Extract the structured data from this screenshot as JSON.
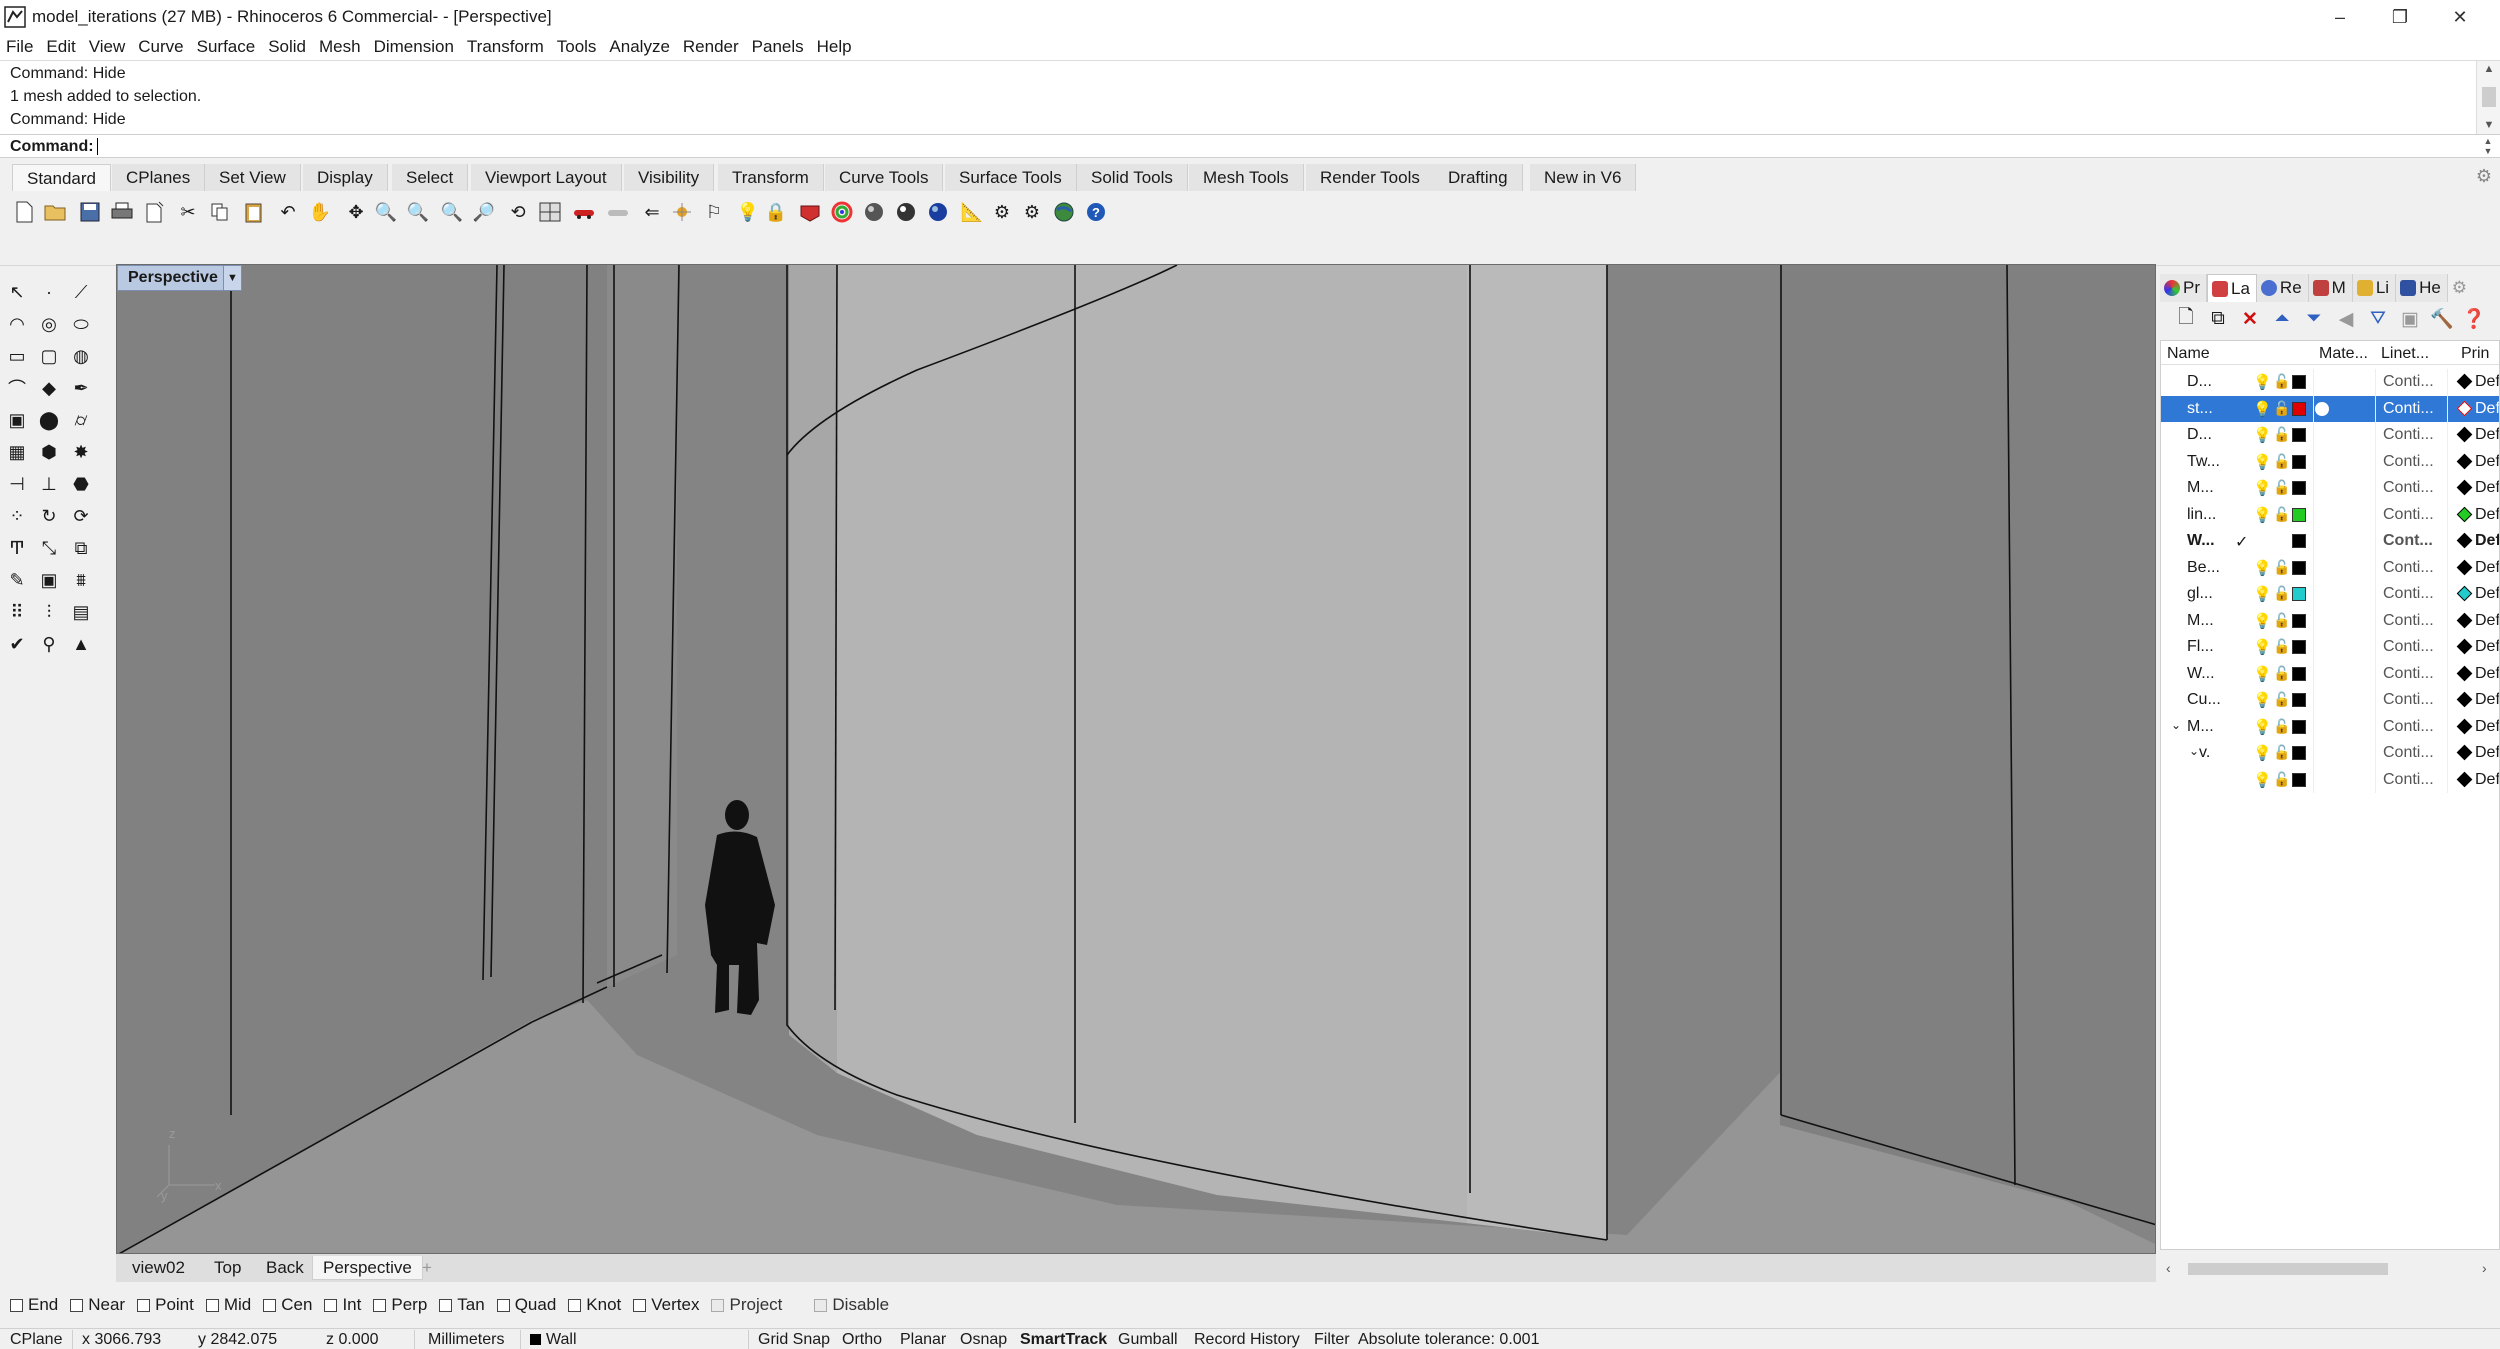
{
  "window": {
    "title": "model_iterations (27 MB) - Rhinoceros 6 Commercial- - [Perspective]",
    "minimize": "–",
    "maximize": "❐",
    "close": "✕"
  },
  "menu": [
    "File",
    "Edit",
    "View",
    "Curve",
    "Surface",
    "Solid",
    "Mesh",
    "Dimension",
    "Transform",
    "Tools",
    "Analyze",
    "Render",
    "Panels",
    "Help"
  ],
  "command_history": [
    "Command: Hide",
    "1 mesh added to selection.",
    "Command: Hide"
  ],
  "command_prompt": {
    "label": "Command:",
    "value": ""
  },
  "toolbar_tabs": [
    "Standard",
    "CPlanes",
    "Set View",
    "Display",
    "Select",
    "Viewport Layout",
    "Visibility",
    "Transform",
    "Curve Tools",
    "Surface Tools",
    "Solid Tools",
    "Mesh Tools",
    "Render Tools",
    "Drafting",
    "New in V6"
  ],
  "toolbar_icons": [
    "new-file",
    "open-file",
    "save",
    "print",
    "import",
    "cut",
    "copy",
    "paste",
    "undo",
    "pan",
    "rotate-view",
    "zoom",
    "zoom-window",
    "zoom-extents",
    "zoom-selected",
    "undo-view",
    "4-views",
    "car-select",
    "hide",
    "show",
    "lock",
    "unlock",
    "light",
    "padlock",
    "render-material",
    "color-wheel",
    "shade-sphere",
    "render-sphere",
    "render-blue",
    "dimension",
    "settings",
    "options",
    "earth",
    "help"
  ],
  "viewport": {
    "name": "Perspective",
    "axis_z": "z",
    "axis_y": "y",
    "axis_x": "x"
  },
  "viewport_tabs": [
    "view02",
    "Top",
    "Back",
    "Perspective",
    "+"
  ],
  "panel_tabs": [
    {
      "label": "Pr",
      "icon": "properties-icon",
      "color": "#e04a3a"
    },
    {
      "label": "La",
      "icon": "layers-icon",
      "color": "#d04040"
    },
    {
      "label": "Re",
      "icon": "render-icon",
      "color": "#4a6fd0"
    },
    {
      "label": "M",
      "icon": "material-icon",
      "color": "#c04040"
    },
    {
      "label": "Li",
      "icon": "library-icon",
      "color": "#e0b030"
    },
    {
      "label": "He",
      "icon": "help-icon",
      "color": "#3050a0"
    }
  ],
  "layer_columns": {
    "name": "Name",
    "material": "Mate...",
    "linetype": "Linet...",
    "print": "Prin"
  },
  "layers": [
    {
      "name": "D...",
      "color": "#000000",
      "linetype": "Conti...",
      "print": "Defa",
      "diamond": "#000000"
    },
    {
      "name": "st...",
      "color": "#e00000",
      "linetype": "Conti...",
      "print": "Defa",
      "diamond": "#e00000",
      "selected": true
    },
    {
      "name": "D...",
      "color": "#000000",
      "linetype": "Conti...",
      "print": "Defa",
      "diamond": "#000000"
    },
    {
      "name": "Tw...",
      "color": "#000000",
      "linetype": "Conti...",
      "print": "Defa",
      "diamond": "#000000",
      "bulb_off": true
    },
    {
      "name": "M...",
      "color": "#000000",
      "linetype": "Conti...",
      "print": "Defa",
      "diamond": "#000000"
    },
    {
      "name": "lin...",
      "color": "#22cc22",
      "linetype": "Conti...",
      "print": "Defa",
      "diamond": "#22cc22"
    },
    {
      "name": "W...",
      "color": "#000000",
      "linetype": "Cont...",
      "print": "Defa",
      "diamond": "#000000",
      "current": true
    },
    {
      "name": "Be...",
      "color": "#000000",
      "linetype": "Conti...",
      "print": "Defa",
      "diamond": "#000000"
    },
    {
      "name": "gl...",
      "color": "#22cccc",
      "linetype": "Conti...",
      "print": "Defa",
      "diamond": "#22cccc"
    },
    {
      "name": "M...",
      "color": "#000000",
      "linetype": "Conti...",
      "print": "Defa",
      "diamond": "#000000"
    },
    {
      "name": "Fl...",
      "color": "#000000",
      "linetype": "Conti...",
      "print": "Defa",
      "diamond": "#000000"
    },
    {
      "name": "W...",
      "color": "#000000",
      "linetype": "Conti...",
      "print": "Defa",
      "diamond": "#000000"
    },
    {
      "name": "Cu...",
      "color": "#000000",
      "linetype": "Conti...",
      "print": "Defa",
      "diamond": "#000000",
      "bulb_off": true
    },
    {
      "name": "M...",
      "color": "#000000",
      "linetype": "Conti...",
      "print": "Defa",
      "diamond": "#000000",
      "expander": "⌄"
    },
    {
      "name": "v.",
      "color": "#000000",
      "linetype": "Conti...",
      "print": "Defa",
      "diamond": "#000000",
      "expander": "⌄"
    },
    {
      "name": "",
      "color": "#000000",
      "linetype": "Conti...",
      "print": "Defa",
      "diamond": "#000000"
    }
  ],
  "osnaps": [
    {
      "label": "End"
    },
    {
      "label": "Near"
    },
    {
      "label": "Point"
    },
    {
      "label": "Mid"
    },
    {
      "label": "Cen"
    },
    {
      "label": "Int"
    },
    {
      "label": "Perp"
    },
    {
      "label": "Tan"
    },
    {
      "label": "Quad"
    },
    {
      "label": "Knot"
    },
    {
      "label": "Vertex"
    },
    {
      "label": "Project"
    },
    {
      "label": "Disable"
    }
  ],
  "status": {
    "cplane": "CPlane",
    "x": "x 3066.793",
    "y": "y 2842.075",
    "z": "z 0.000",
    "units": "Millimeters",
    "layer": "Wall",
    "grid_snap": "Grid Snap",
    "ortho": "Ortho",
    "planar": "Planar",
    "osnap": "Osnap",
    "smarttrack": "SmartTrack",
    "gumball": "Gumball",
    "record_history": "Record History",
    "filter": "Filter",
    "tolerance": "Absolute tolerance: 0.001"
  }
}
